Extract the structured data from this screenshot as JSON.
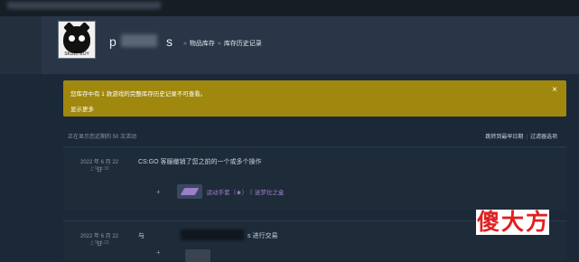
{
  "header": {
    "username_prefix": "p",
    "username_suffix": "s",
    "breadcrumb": [
      "物品库存",
      "库存历史记录"
    ],
    "avatar_caption": "SKULL BOY"
  },
  "notice": {
    "message": "您库存中有 1 款游戏的完整库存历史记录不可查看。",
    "link": "显示更多",
    "close": "×"
  },
  "meta": {
    "summary": "正在显示您近期的 50 次活动",
    "actions": [
      "跳转到最早日期",
      "过滤器选项"
    ]
  },
  "events": [
    {
      "date": "2022 年 6 月 22 日",
      "time": "上午 1:30",
      "description": "CS:GO 客服撤销了您之前的一个或多个操作",
      "item_name": "运动手套（★）",
      "item_case": "迷梦拉之盒"
    },
    {
      "date": "2022 年 6 月 22 日",
      "time": "上午 1:23",
      "trade_prefix": "与",
      "trade_suffix": "s 进行交易"
    }
  ],
  "watermark": [
    "傻",
    "大",
    "方"
  ],
  "colors": {
    "background": "#1b2838",
    "notice": "#a0880f",
    "item_purple": "#9b7fc7",
    "watermark_red": "#e02020"
  }
}
